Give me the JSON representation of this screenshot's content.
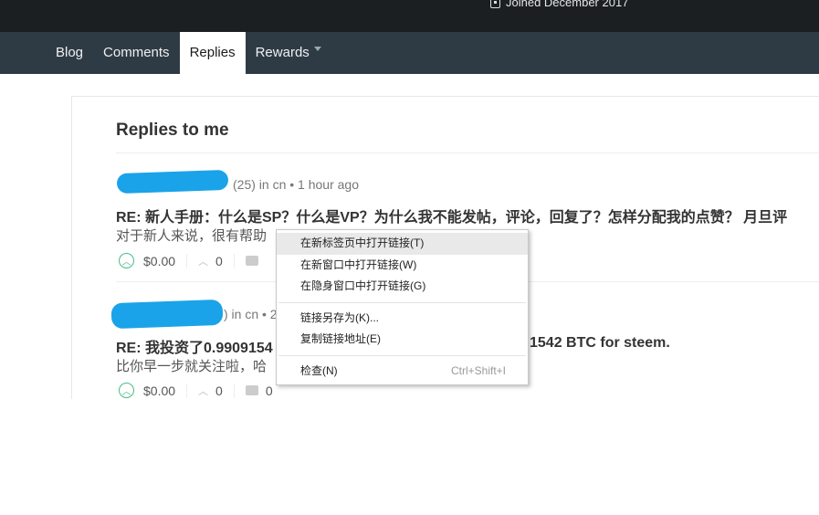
{
  "header": {
    "joined": "Joined December 2017"
  },
  "nav": {
    "tabs": [
      {
        "label": "Blog"
      },
      {
        "label": "Comments"
      },
      {
        "label": "Replies",
        "active": true
      },
      {
        "label": "Rewards"
      }
    ]
  },
  "page_title": "Replies to me",
  "replies": [
    {
      "meta": "(25) in cn • 1 hour ago",
      "title": "RE: 新人手册：什么是SP？什么是VP？为什么我不能发帖，评论，回复了？怎样分配我的点赞？ 月旦评",
      "body": "对于新人来说，很有帮助",
      "payout": "$0.00",
      "votes": "0",
      "comments": ""
    },
    {
      "meta": ") in cn • 2",
      "title_start": "RE: 我投资了0.9909154",
      "title_end": "1542 BTC for steem.",
      "body": "比你早一步就关注啦，哈",
      "payout": "$0.00",
      "votes": "0",
      "comments": "0"
    }
  ],
  "context_menu": {
    "items": [
      {
        "label": "在新标签页中打开链接(T)"
      },
      {
        "label": "在新窗口中打开链接(W)"
      },
      {
        "label": "在隐身窗口中打开链接(G)"
      },
      {
        "label": "链接另存为(K)..."
      },
      {
        "label": "复制链接地址(E)"
      },
      {
        "label": "检查(N)",
        "shortcut": "Ctrl+Shift+I"
      }
    ]
  },
  "colors": {
    "accent": "#4bba8a",
    "nav_bg": "#2e3b45",
    "redaction": "#1aa3e8"
  }
}
